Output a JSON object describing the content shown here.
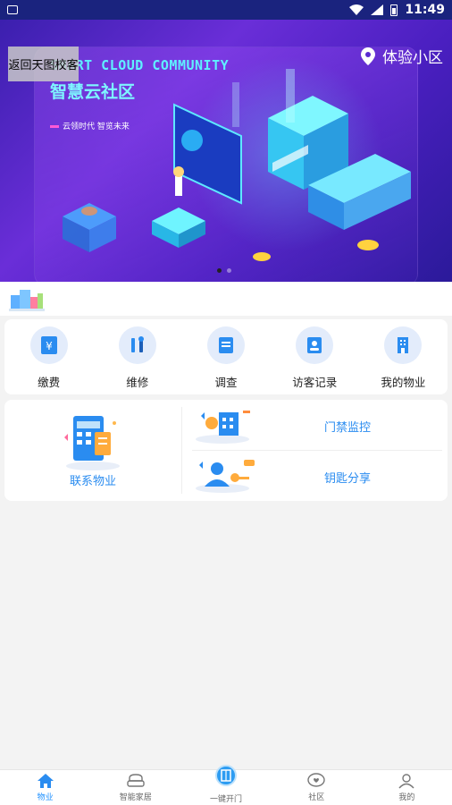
{
  "status_bar": {
    "time": "11:49"
  },
  "banner": {
    "back_label": "返回天图校客",
    "location": "体验小区",
    "brand_title": "SMART CLOUD COMMUNITY",
    "brand_subtitle": "智慧云社区",
    "brand_tagline": "云领时代 智览未来",
    "carousel": {
      "pages": 2,
      "active": 1
    }
  },
  "quick_actions": [
    {
      "label": "缴费",
      "icon": "payment-icon"
    },
    {
      "label": "维修",
      "icon": "repair-icon"
    },
    {
      "label": "调查",
      "icon": "survey-icon"
    },
    {
      "label": "访客记录",
      "icon": "visitor-record-icon"
    },
    {
      "label": "我的物业",
      "icon": "my-property-icon"
    }
  ],
  "features": {
    "contact_property": "联系物业",
    "access_monitor": "门禁监控",
    "key_share": "钥匙分享"
  },
  "tabs": [
    {
      "label": "物业",
      "icon": "home-icon",
      "active": true
    },
    {
      "label": "智能家居",
      "icon": "sofa-icon",
      "active": false
    },
    {
      "label": "一键开门",
      "icon": "door-icon",
      "active": false
    },
    {
      "label": "社区",
      "icon": "heart-chat-icon",
      "active": false
    },
    {
      "label": "我的",
      "icon": "user-icon",
      "active": false
    }
  ],
  "colors": {
    "accent": "#2a8cf0",
    "status_bar": "#1a237e",
    "icon_bg": "#e3ecfb"
  }
}
